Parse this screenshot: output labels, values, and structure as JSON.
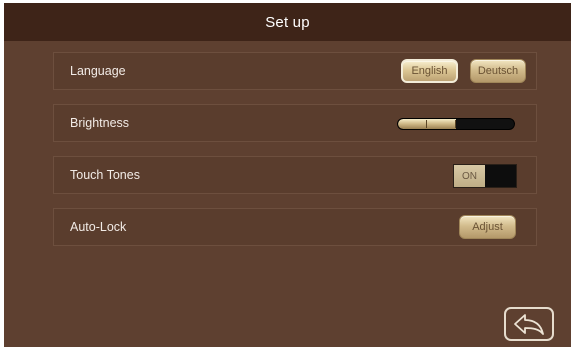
{
  "header": {
    "title": "Set up"
  },
  "settings": {
    "language": {
      "label": "Language",
      "options": [
        "English",
        "Deutsch"
      ],
      "selected": "English"
    },
    "brightness": {
      "label": "Brightness",
      "level_percent": 50
    },
    "touch_tones": {
      "label": "Touch Tones",
      "state": "ON"
    },
    "auto_lock": {
      "label": "Auto-Lock",
      "button_label": "Adjust"
    }
  },
  "footer": {
    "back_icon": "back-arrow-icon"
  },
  "colors": {
    "background": "#5e4030",
    "title_bar": "#3e2418",
    "row": "#5a3d2d",
    "gold_accent": "#d2bc8d",
    "text": "#f2ebe6"
  }
}
